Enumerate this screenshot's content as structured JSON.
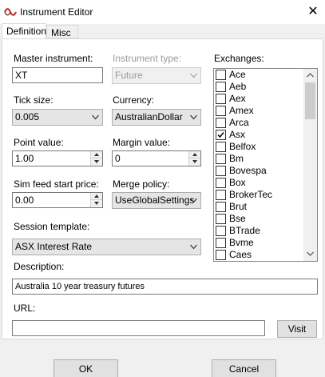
{
  "window": {
    "title": "Instrument Editor",
    "close_glyph": "✕"
  },
  "tabs": [
    {
      "label": "Definition",
      "selected": true
    },
    {
      "label": "Misc",
      "selected": false
    }
  ],
  "form": {
    "master_instrument": {
      "label": "Master instrument:",
      "value": "XT"
    },
    "instrument_type": {
      "label": "Instrument type:",
      "value": "Future",
      "enabled": false
    },
    "tick_size": {
      "label": "Tick size:",
      "value": "0.005"
    },
    "currency": {
      "label": "Currency:",
      "value": "AustralianDollar"
    },
    "point_value": {
      "label": "Point value:",
      "value": "1.00"
    },
    "margin_value": {
      "label": "Margin value:",
      "value": "0"
    },
    "sim_feed_start_price": {
      "label": "Sim feed start price:",
      "value": "0.00"
    },
    "merge_policy": {
      "label": "Merge policy:",
      "value": "UseGlobalSettings"
    },
    "session_template": {
      "label": "Session template:",
      "value": "ASX Interest Rate"
    },
    "description": {
      "label": "Description:",
      "value": "Australia 10 year treasury futures"
    },
    "url": {
      "label": "URL:",
      "value": ""
    }
  },
  "exchanges": {
    "label": "Exchanges:",
    "items": [
      {
        "name": "Ace",
        "checked": false
      },
      {
        "name": "Aeb",
        "checked": false
      },
      {
        "name": "Aex",
        "checked": false
      },
      {
        "name": "Amex",
        "checked": false
      },
      {
        "name": "Arca",
        "checked": false
      },
      {
        "name": "Asx",
        "checked": true
      },
      {
        "name": "Belfox",
        "checked": false
      },
      {
        "name": "Bm",
        "checked": false
      },
      {
        "name": "Bovespa",
        "checked": false
      },
      {
        "name": "Box",
        "checked": false
      },
      {
        "name": "BrokerTec",
        "checked": false
      },
      {
        "name": "Brut",
        "checked": false
      },
      {
        "name": "Bse",
        "checked": false
      },
      {
        "name": "BTrade",
        "checked": false
      },
      {
        "name": "Bvme",
        "checked": false
      },
      {
        "name": "Caes",
        "checked": false
      }
    ]
  },
  "buttons": {
    "visit": "Visit",
    "ok": "OK",
    "cancel": "Cancel"
  },
  "colors": {
    "brand_icon": "#c0392b",
    "checkmark": "#000000"
  }
}
